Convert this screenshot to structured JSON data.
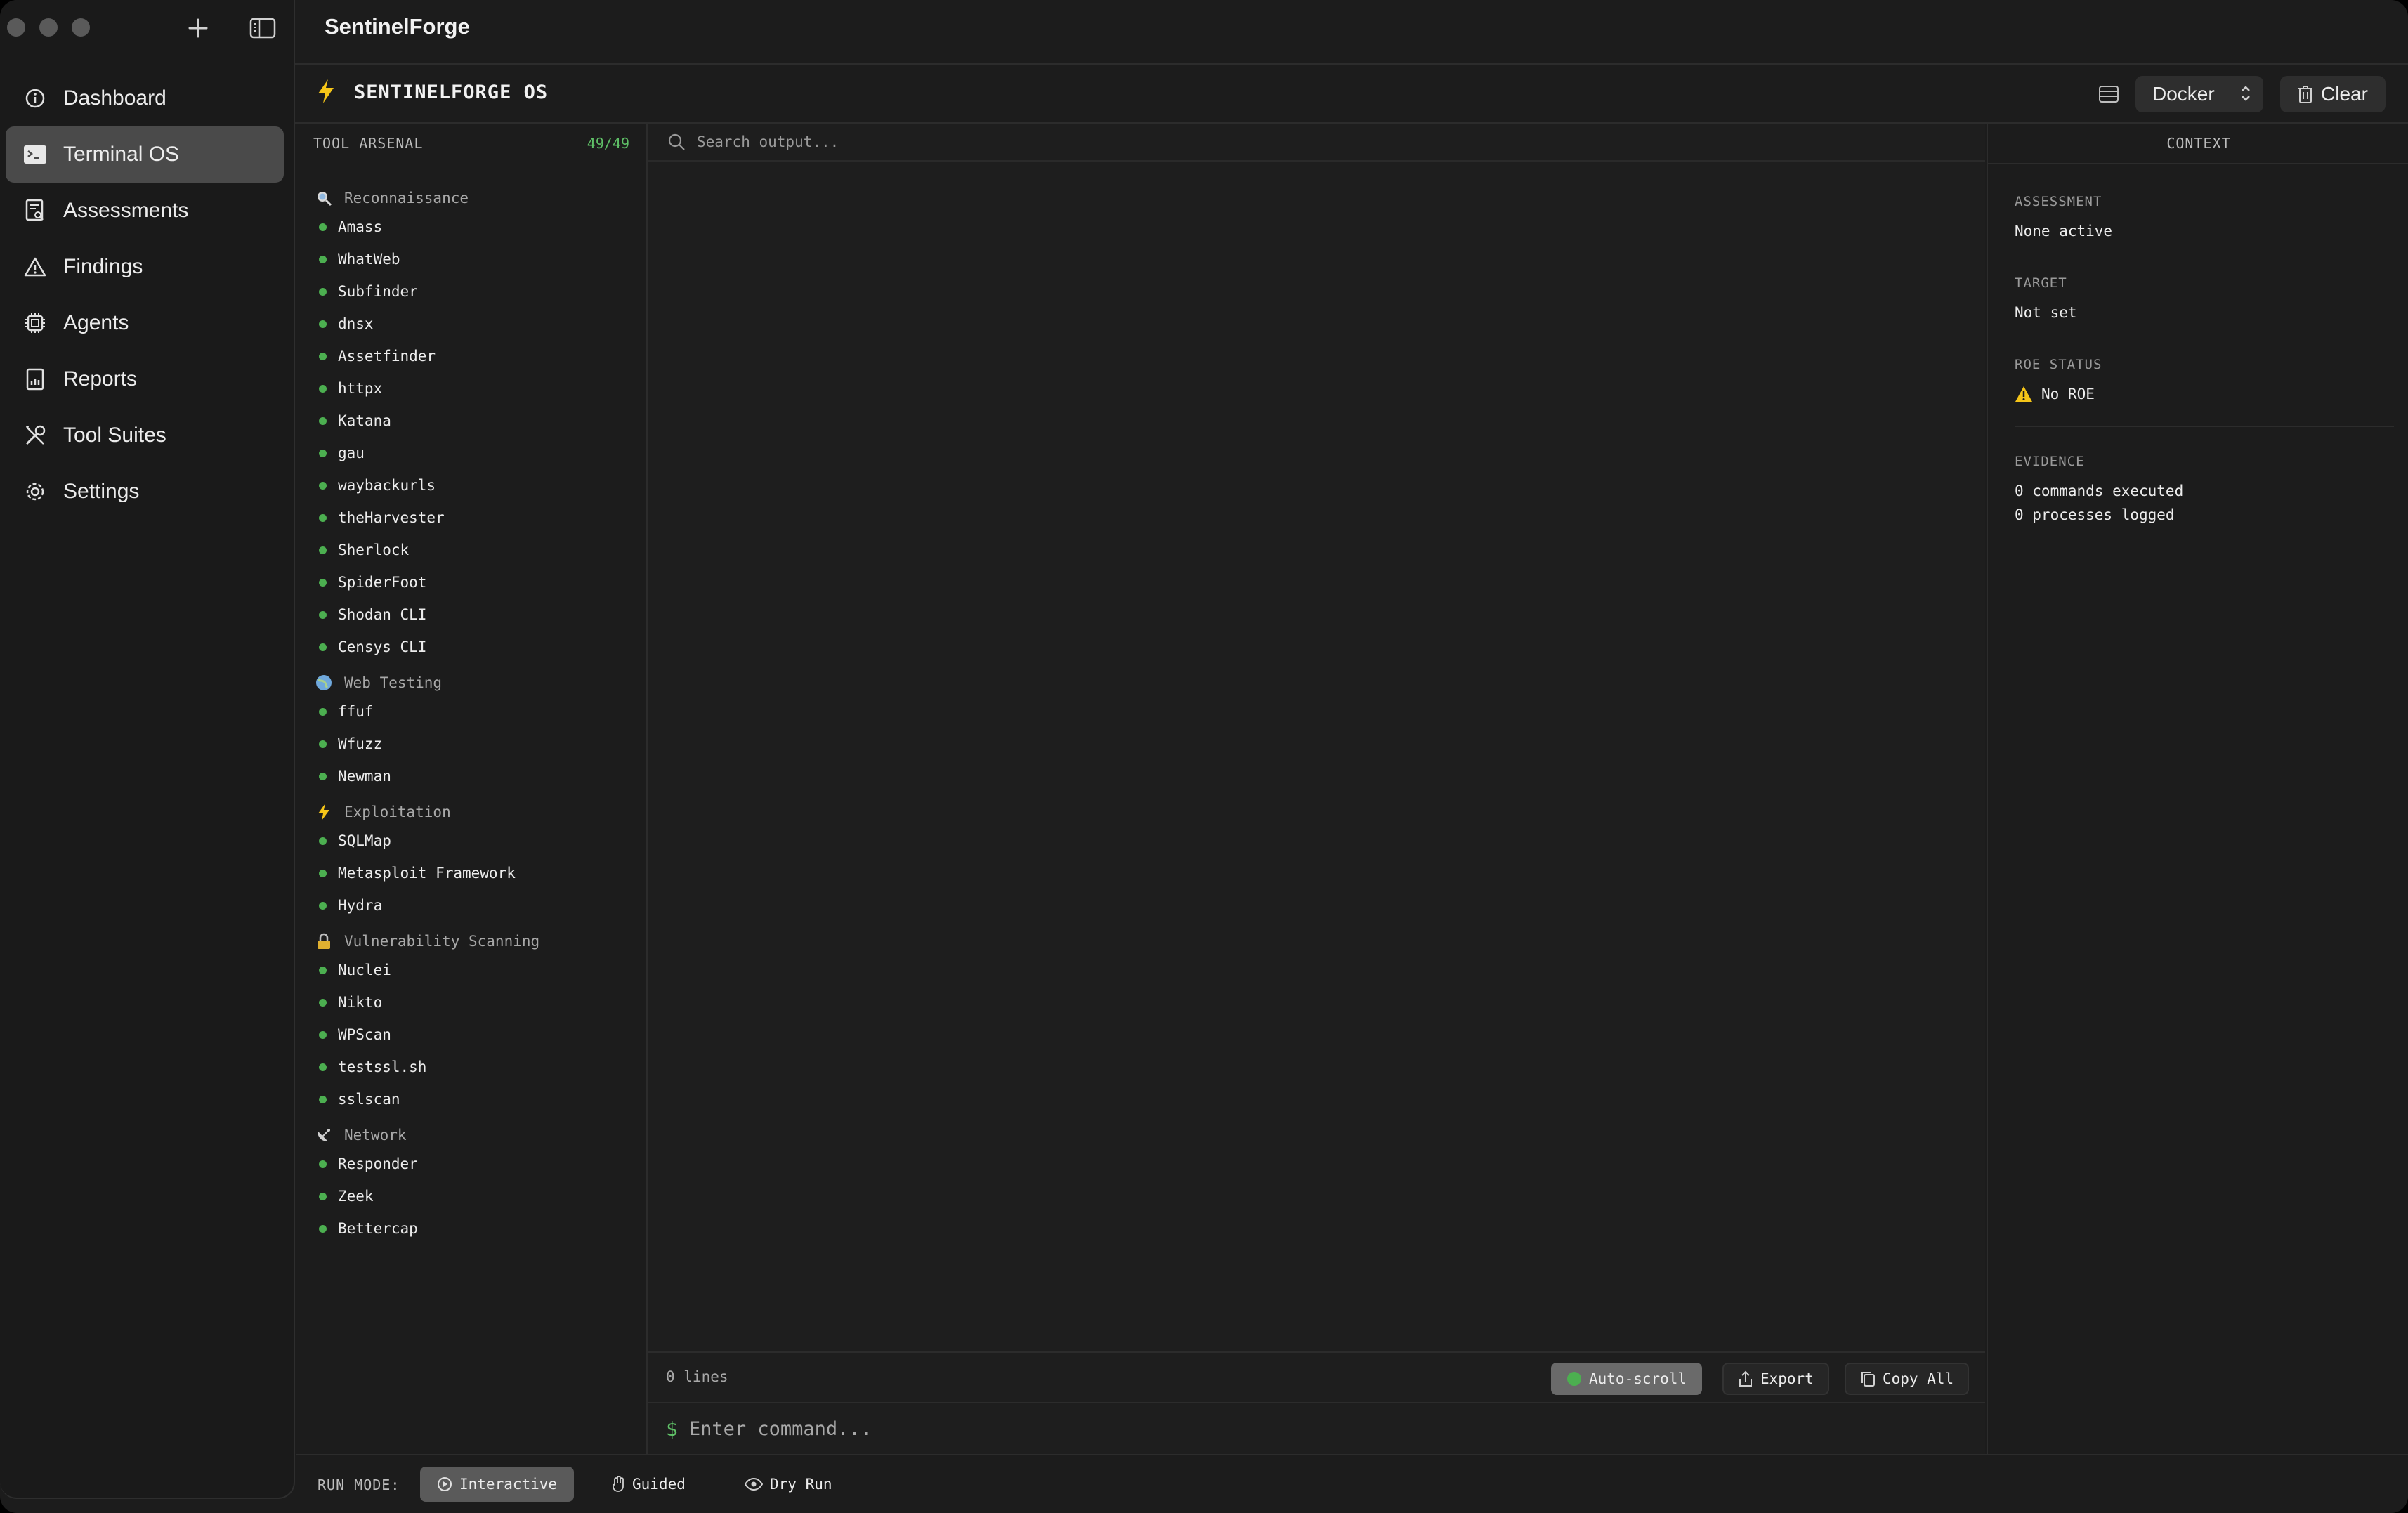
{
  "app": {
    "title": "SentinelForge"
  },
  "sidebar": {
    "items": [
      {
        "label": "Dashboard",
        "icon": "info-circle-icon",
        "active": false
      },
      {
        "label": "Terminal OS",
        "icon": "terminal-icon",
        "active": true
      },
      {
        "label": "Assessments",
        "icon": "clipboard-search-icon",
        "active": false
      },
      {
        "label": "Findings",
        "icon": "warning-triangle-icon",
        "active": false
      },
      {
        "label": "Agents",
        "icon": "cpu-icon",
        "active": false
      },
      {
        "label": "Reports",
        "icon": "report-icon",
        "active": false
      },
      {
        "label": "Tool Suites",
        "icon": "wrench-screwdriver-icon",
        "active": false
      },
      {
        "label": "Settings",
        "icon": "gear-icon",
        "active": false
      }
    ]
  },
  "header": {
    "title": "SENTINELFORGE OS",
    "environment": "Docker",
    "clear_label": "Clear"
  },
  "arsenal": {
    "title": "TOOL ARSENAL",
    "count": "49/49",
    "categories": [
      {
        "name": "Reconnaissance",
        "icon": "magnifier-icon",
        "tools": [
          "Amass",
          "WhatWeb",
          "Subfinder",
          "dnsx",
          "Assetfinder",
          "httpx",
          "Katana",
          "gau",
          "waybackurls",
          "theHarvester",
          "Sherlock",
          "SpiderFoot",
          "Shodan CLI",
          "Censys CLI"
        ]
      },
      {
        "name": "Web Testing",
        "icon": "globe-icon",
        "tools": [
          "ffuf",
          "Wfuzz",
          "Newman"
        ]
      },
      {
        "name": "Exploitation",
        "icon": "lightning-icon",
        "tools": [
          "SQLMap",
          "Metasploit Framework",
          "Hydra"
        ]
      },
      {
        "name": "Vulnerability Scanning",
        "icon": "lock-icon",
        "tools": [
          "Nuclei",
          "Nikto",
          "WPScan",
          "testssl.sh",
          "sslscan"
        ]
      },
      {
        "name": "Network",
        "icon": "satellite-dish-icon",
        "tools": [
          "Responder",
          "Zeek",
          "Bettercap"
        ]
      }
    ]
  },
  "output": {
    "search_placeholder": "Search output...",
    "line_count": "0 lines",
    "autoscroll_label": "Auto-scroll",
    "export_label": "Export",
    "copy_label": "Copy All",
    "prompt": "$",
    "command_placeholder": "Enter command..."
  },
  "context": {
    "title": "CONTEXT",
    "assessment_label": "ASSESSMENT",
    "assessment_value": "None active",
    "target_label": "TARGET",
    "target_value": "Not set",
    "roe_label": "ROE STATUS",
    "roe_value": "No ROE",
    "evidence_label": "EVIDENCE",
    "evidence_commands": "0 commands executed",
    "evidence_processes": "0 processes logged"
  },
  "runmode": {
    "label": "RUN MODE:",
    "modes": [
      "Interactive",
      "Guided",
      "Dry Run"
    ],
    "active": "Interactive"
  },
  "colors": {
    "accent_green": "#4caf50",
    "bolt_yellow": "#f5c518",
    "warning_yellow": "#f5c518"
  }
}
